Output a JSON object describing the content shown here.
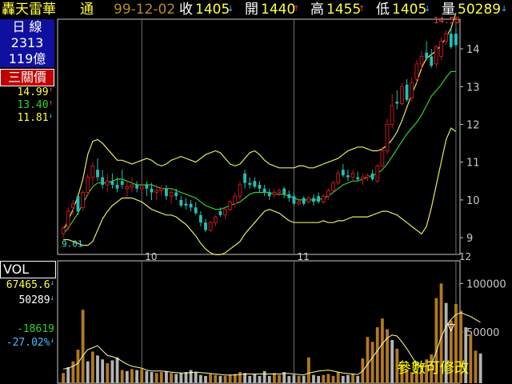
{
  "header": {
    "stock_name": "轟天雷華",
    "market": "通",
    "date": "99-12-02",
    "close_label": "收",
    "close_value": "1405",
    "open_label": "開",
    "open_value": "1440",
    "high_label": "高",
    "high_value": "1455",
    "low_label": "低",
    "low_value": "1405",
    "volume_label": "量",
    "volume_value": "50289"
  },
  "side": {
    "period_line1": "日  線",
    "index_number": "2313",
    "amount": "119億",
    "indicator_name": "三關價",
    "ind_values": [
      "14.99",
      "13.40",
      "11.81"
    ],
    "vol_title": "VOL",
    "vol_values": [
      "67465.6",
      "50289",
      "-18619",
      "-27.02%"
    ]
  },
  "overlay_text": "參數可修改",
  "colors": {
    "up": "#c8141e",
    "down": "#20c0b8",
    "band": "#e8e860",
    "ma": "#30d030",
    "vol_up": "#b07a20",
    "vol_down": "#b4b4b4",
    "axis": "#c8c8c8",
    "grid": "#707070"
  },
  "chart_data": [
    {
      "type": "candlestick",
      "title": "",
      "y_ticks": [
        9,
        10,
        11,
        12,
        13,
        14
      ],
      "ylim": [
        8.6,
        14.7
      ],
      "x_ticks": [
        "10",
        "11",
        "12"
      ],
      "x_tick_indices": [
        16,
        47,
        80
      ],
      "annotations": [
        {
          "text": "9.01",
          "index": 0,
          "value": 9.01
        },
        {
          "text": "14.55",
          "index": 80,
          "value": 14.55
        }
      ],
      "ohlc": [
        [
          9.1,
          9.3,
          9.0,
          9.25
        ],
        [
          9.3,
          9.8,
          9.2,
          9.7
        ],
        [
          9.8,
          10.0,
          9.6,
          9.9
        ],
        [
          10.1,
          9.8,
          9.6,
          9.7
        ],
        [
          9.8,
          10.25,
          9.7,
          10.2
        ],
        [
          10.2,
          10.7,
          10.1,
          10.6
        ],
        [
          10.6,
          11.0,
          10.4,
          10.9
        ],
        [
          10.8,
          11.1,
          10.5,
          10.6
        ],
        [
          10.6,
          10.8,
          10.3,
          10.4
        ],
        [
          10.4,
          10.7,
          10.2,
          10.5
        ],
        [
          10.5,
          10.7,
          10.3,
          10.4
        ],
        [
          10.4,
          10.6,
          10.2,
          10.3
        ],
        [
          10.5,
          10.8,
          10.3,
          10.4
        ],
        [
          10.3,
          10.5,
          10.1,
          10.35
        ],
        [
          10.35,
          10.6,
          10.2,
          10.4
        ],
        [
          10.4,
          10.5,
          10.2,
          10.3
        ],
        [
          10.3,
          10.5,
          10.2,
          10.35
        ],
        [
          10.4,
          10.5,
          10.1,
          10.3
        ],
        [
          10.3,
          10.45,
          10.0,
          10.2
        ],
        [
          10.2,
          10.4,
          10.0,
          10.25
        ],
        [
          10.25,
          10.4,
          10.1,
          10.3
        ],
        [
          10.3,
          10.4,
          10.0,
          10.1
        ],
        [
          10.1,
          10.3,
          9.9,
          10.2
        ],
        [
          10.2,
          10.3,
          10.0,
          10.1
        ],
        [
          10.0,
          10.1,
          9.8,
          9.85
        ],
        [
          9.9,
          10.05,
          9.75,
          9.85
        ],
        [
          9.9,
          10.0,
          9.7,
          9.8
        ],
        [
          9.8,
          9.95,
          9.6,
          9.65
        ],
        [
          9.6,
          9.7,
          9.3,
          9.4
        ],
        [
          9.4,
          9.5,
          9.15,
          9.2
        ],
        [
          9.2,
          9.45,
          9.15,
          9.4
        ],
        [
          9.4,
          9.6,
          9.3,
          9.55
        ],
        [
          9.7,
          9.8,
          9.55,
          9.6
        ],
        [
          9.6,
          9.8,
          9.5,
          9.75
        ],
        [
          9.75,
          10.0,
          9.7,
          9.95
        ],
        [
          9.9,
          10.2,
          9.8,
          10.1
        ],
        [
          10.1,
          10.5,
          10.0,
          10.4
        ],
        [
          10.7,
          10.8,
          10.3,
          10.45
        ],
        [
          10.45,
          10.6,
          10.3,
          10.4
        ],
        [
          10.5,
          10.6,
          10.3,
          10.35
        ],
        [
          10.4,
          10.5,
          10.2,
          10.3
        ],
        [
          10.3,
          10.4,
          10.1,
          10.2
        ],
        [
          10.2,
          10.3,
          10.0,
          10.1
        ],
        [
          10.15,
          10.3,
          10.05,
          10.2
        ],
        [
          10.2,
          10.3,
          10.1,
          10.25
        ],
        [
          10.3,
          10.35,
          10.05,
          10.15
        ],
        [
          10.15,
          10.25,
          9.95,
          10.05
        ],
        [
          10.1,
          10.2,
          9.85,
          9.9
        ],
        [
          9.9,
          10.0,
          9.85,
          9.95
        ],
        [
          10.05,
          10.1,
          9.85,
          9.9
        ],
        [
          9.95,
          10.1,
          9.9,
          10.05
        ],
        [
          10.05,
          10.15,
          9.85,
          9.95
        ],
        [
          10.1,
          10.2,
          9.9,
          9.95
        ],
        [
          9.95,
          10.15,
          9.9,
          10.1
        ],
        [
          10.1,
          10.3,
          10.0,
          10.25
        ],
        [
          10.25,
          10.5,
          10.2,
          10.45
        ],
        [
          10.45,
          10.8,
          10.4,
          10.7
        ],
        [
          10.8,
          10.95,
          10.6,
          10.65
        ],
        [
          10.65,
          10.8,
          10.5,
          10.6
        ],
        [
          10.6,
          10.8,
          10.5,
          10.7
        ],
        [
          10.6,
          10.75,
          10.5,
          10.55
        ],
        [
          10.55,
          10.7,
          10.4,
          10.6
        ],
        [
          10.6,
          10.7,
          10.5,
          10.65
        ],
        [
          10.7,
          10.8,
          10.5,
          10.55
        ],
        [
          10.5,
          10.95,
          10.45,
          10.9
        ],
        [
          10.9,
          11.4,
          10.85,
          11.3
        ],
        [
          11.3,
          12.15,
          11.2,
          12.0
        ],
        [
          12.0,
          12.8,
          11.9,
          12.5
        ],
        [
          12.6,
          12.9,
          12.4,
          12.55
        ],
        [
          12.55,
          13.1,
          12.5,
          13.0
        ],
        [
          13.05,
          13.2,
          12.6,
          12.65
        ],
        [
          12.7,
          13.25,
          12.6,
          13.1
        ],
        [
          13.2,
          13.7,
          13.1,
          13.6
        ],
        [
          13.6,
          13.95,
          13.4,
          13.8
        ],
        [
          13.9,
          14.2,
          13.7,
          13.75
        ],
        [
          13.8,
          14.0,
          13.5,
          13.55
        ],
        [
          13.6,
          14.1,
          13.5,
          14.05
        ],
        [
          13.8,
          14.3,
          13.7,
          14.2
        ],
        [
          14.2,
          14.5,
          14.1,
          14.4
        ],
        [
          14.4,
          14.55,
          14.0,
          14.05
        ],
        [
          14.4,
          14.55,
          14.05,
          14.1
        ]
      ],
      "series": [
        {
          "name": "",
          "values": [
            9.2,
            9.45,
            9.75,
            10.1,
            10.55,
            11.2,
            11.55,
            11.6,
            11.5,
            11.35,
            11.2,
            11.05,
            11.05,
            11.0,
            10.95,
            11.0,
            11.05,
            11.1,
            11.05,
            10.95,
            10.9,
            10.95,
            11.05,
            11.1,
            11.15,
            11.1,
            11.05,
            11.0,
            11.1,
            11.2,
            11.25,
            11.3,
            11.25,
            11.1,
            10.95,
            10.9,
            10.95,
            11.1,
            11.25,
            11.3,
            11.2,
            11.05,
            10.95,
            10.9,
            10.85,
            10.85,
            10.85,
            10.85,
            10.9,
            10.9,
            10.85,
            10.85,
            10.9,
            10.95,
            11.0,
            11.05,
            11.1,
            11.2,
            11.3,
            11.35,
            11.4,
            11.4,
            11.35,
            11.3,
            11.3,
            11.35,
            11.45,
            11.6,
            11.8,
            12.1,
            12.45,
            12.8,
            13.1,
            13.5,
            13.75,
            13.85,
            13.95,
            14.1,
            14.3,
            14.55,
            14.95
          ]
        },
        {
          "name": "",
          "values": [
            9.1,
            9.25,
            9.45,
            9.65,
            9.9,
            10.15,
            10.35,
            10.45,
            10.45,
            10.45,
            10.5,
            10.55,
            10.55,
            10.5,
            10.45,
            10.4,
            10.4,
            10.4,
            10.4,
            10.35,
            10.3,
            10.3,
            10.3,
            10.25,
            10.2,
            10.15,
            10.1,
            10.05,
            9.95,
            9.85,
            9.8,
            9.75,
            9.75,
            9.8,
            9.85,
            9.9,
            9.95,
            10.05,
            10.15,
            10.2,
            10.2,
            10.2,
            10.2,
            10.15,
            10.15,
            10.15,
            10.1,
            10.05,
            10.0,
            10.0,
            10.0,
            10.0,
            10.0,
            10.05,
            10.1,
            10.2,
            10.3,
            10.4,
            10.45,
            10.5,
            10.5,
            10.55,
            10.6,
            10.65,
            10.7,
            10.8,
            10.95,
            11.15,
            11.35,
            11.55,
            11.75,
            11.9,
            12.05,
            12.25,
            12.5,
            12.75,
            12.9,
            13.05,
            13.25,
            13.4,
            13.4
          ]
        },
        {
          "name": "",
          "values": [
            8.95,
            8.95,
            8.9,
            8.85,
            8.8,
            8.8,
            8.9,
            9.2,
            9.5,
            9.7,
            9.85,
            9.95,
            10.05,
            10.05,
            10.05,
            10.0,
            9.95,
            9.85,
            9.75,
            9.7,
            9.65,
            9.6,
            9.6,
            9.55,
            9.45,
            9.35,
            9.2,
            9.05,
            8.85,
            8.7,
            8.6,
            8.55,
            8.55,
            8.6,
            8.7,
            8.8,
            8.9,
            9.1,
            9.25,
            9.4,
            9.55,
            9.7,
            9.75,
            9.7,
            9.65,
            9.55,
            9.45,
            9.4,
            9.4,
            9.4,
            9.4,
            9.4,
            9.4,
            9.45,
            9.4,
            9.4,
            9.45,
            9.45,
            9.5,
            9.55,
            9.55,
            9.55,
            9.55,
            9.6,
            9.65,
            9.7,
            9.7,
            9.65,
            9.6,
            9.5,
            9.4,
            9.3,
            9.2,
            9.1,
            9.3,
            9.8,
            10.4,
            11.0,
            11.6,
            11.9,
            11.81
          ]
        }
      ]
    },
    {
      "type": "bar",
      "title": "",
      "y_ticks": [
        50000,
        100000
      ],
      "ylim": [
        0,
        120000
      ],
      "values": [
        8000,
        14000,
        20000,
        32000,
        73000,
        20000,
        30000,
        26000,
        22000,
        18000,
        21000,
        24000,
        11000,
        10000,
        12000,
        11000,
        12000,
        10000,
        9000,
        8000,
        9000,
        10000,
        8000,
        7000,
        8000,
        9000,
        11000,
        9000,
        6000,
        5000,
        7000,
        6000,
        5000,
        5000,
        6000,
        7000,
        9000,
        8000,
        5000,
        7000,
        5000,
        10000,
        5000,
        8000,
        6000,
        9000,
        5000,
        6000,
        5000,
        5000,
        24000,
        6000,
        5000,
        6000,
        7000,
        5000,
        9000,
        5000,
        6000,
        7000,
        5000,
        23000,
        45000,
        40000,
        55000,
        64000,
        53000,
        42000,
        33000,
        17000,
        12000,
        9000,
        10000,
        16000,
        22000,
        27000,
        85000,
        100000,
        80000,
        62000,
        79000,
        72000,
        55000,
        48000,
        31000,
        28000
      ],
      "up": [
        1,
        0,
        1,
        1,
        1,
        0,
        1,
        0,
        0,
        1,
        0,
        0,
        1,
        0,
        1,
        0,
        1,
        0,
        0,
        1,
        1,
        0,
        1,
        0,
        0,
        0,
        0,
        0,
        0,
        0,
        1,
        1,
        0,
        1,
        1,
        1,
        1,
        0,
        0,
        0,
        0,
        0,
        0,
        1,
        1,
        0,
        0,
        0,
        1,
        0,
        1,
        0,
        0,
        1,
        1,
        1,
        1,
        0,
        0,
        1,
        0,
        1,
        1,
        1,
        1,
        1,
        1,
        0,
        1,
        1,
        1,
        1,
        1,
        1,
        1,
        1,
        1,
        1,
        0,
        1,
        1,
        1,
        0,
        1,
        1,
        0
      ],
      "series": [
        {
          "name": "",
          "values": [
            12000,
            13000,
            15000,
            18000,
            26000,
            32000,
            34000,
            36000,
            31000,
            26000,
            25000,
            23000,
            20000,
            17000,
            15000,
            14000,
            13000,
            11000,
            10000,
            10000,
            10000,
            9500,
            9000,
            8500,
            8000,
            8000,
            8500,
            9000,
            8500,
            8000,
            7500,
            7000,
            6500,
            6000,
            6000,
            6000,
            6500,
            7000,
            7000,
            7000,
            7000,
            7000,
            7000,
            7000,
            7000,
            7500,
            7500,
            7000,
            6500,
            6000,
            8000,
            9000,
            10000,
            10500,
            11000,
            10000,
            9000,
            8000,
            7500,
            7000,
            6500,
            10000,
            17000,
            24000,
            31000,
            38000,
            44000,
            47000,
            46000,
            40000,
            33000,
            25000,
            17000,
            15000,
            15000,
            17000,
            30000,
            45000,
            56000,
            63000,
            68000,
            70000,
            68000,
            66000,
            63000,
            60000
          ]
        }
      ]
    }
  ]
}
